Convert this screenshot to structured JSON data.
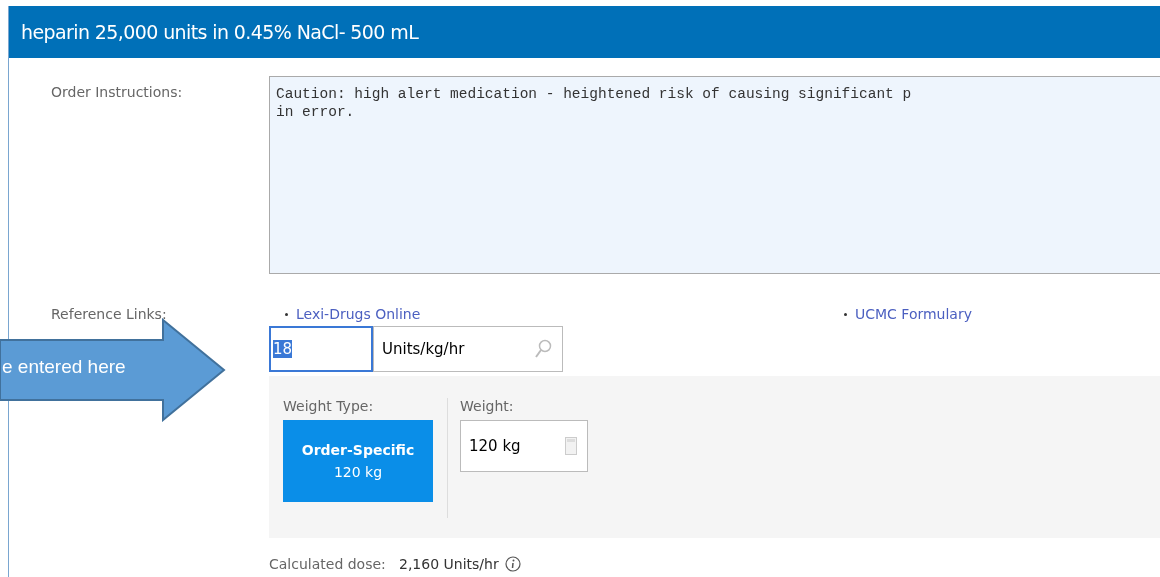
{
  "window": {
    "title": "heparin 25,000 units in 0.45% NaCl- 500 mL"
  },
  "order_instructions": {
    "label": "Order Instructions:",
    "lines": [
      "Caution: high alert medication - heightened risk of causing significant p",
      "in error."
    ]
  },
  "reference_links": {
    "label": "Reference Links:",
    "links": [
      "Lexi-Drugs Online",
      "UCMC Formulary"
    ]
  },
  "dose": {
    "value": "18",
    "unit": "Units/kg/hr"
  },
  "weight": {
    "type_label": "Weight Type:",
    "types": [
      {
        "name": "Order-Specific",
        "value": "120 kg",
        "selected": true
      }
    ],
    "weight_label": "Weight:",
    "weight_value": "120 kg"
  },
  "calculated_dose": {
    "label": "Calculated dose:",
    "value": "2,160 Units/hr"
  },
  "callout": {
    "text": "e entered here"
  }
}
